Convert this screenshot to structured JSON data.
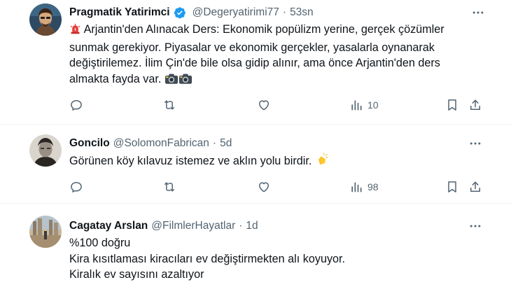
{
  "tweets": [
    {
      "name": "Pragmatik Yatirimci",
      "verified": true,
      "handle": "@Degeryatirimi77",
      "separator": "·",
      "time": "53sn",
      "lines": [
        "Arjantin'den Alınacak Ders: Ekonomik popülizm yerine, gerçek çözümler",
        "sunmak gerekiyor. Piyasalar ve ekonomik gerçekler, yasalarla oynanarak",
        "değiştirilemez. İlim Çin'de bile olsa gidip alınır, ama önce Arjantin'den ders",
        "almakta fayda var."
      ],
      "leading_emoji": "rotating-light-icon",
      "trailing_emoji": "camera-flash-icon",
      "views": "10"
    },
    {
      "name": "Goncilo",
      "handle": "@SolomonFabrican",
      "separator": "·",
      "time": "5d",
      "lines": [
        "Görünen köy kılavuz istemez ve aklın yolu birdir."
      ],
      "trailing_emoji": "clapping-hands-icon",
      "views": "98"
    },
    {
      "name": "Cagatay Arslan",
      "handle": "@FilmlerHayatlar",
      "separator": "·",
      "time": "1d",
      "lines": [
        "%100 doğru",
        "Kira kısıtlaması kiracıları ev değiştirmekten alı koyuyor.",
        "Kiralık ev sayısını azaltıyor"
      ]
    }
  ],
  "colors": {
    "verified": "#1d9bf0",
    "secondary_text": "#536471",
    "divider": "#eff3f4"
  }
}
